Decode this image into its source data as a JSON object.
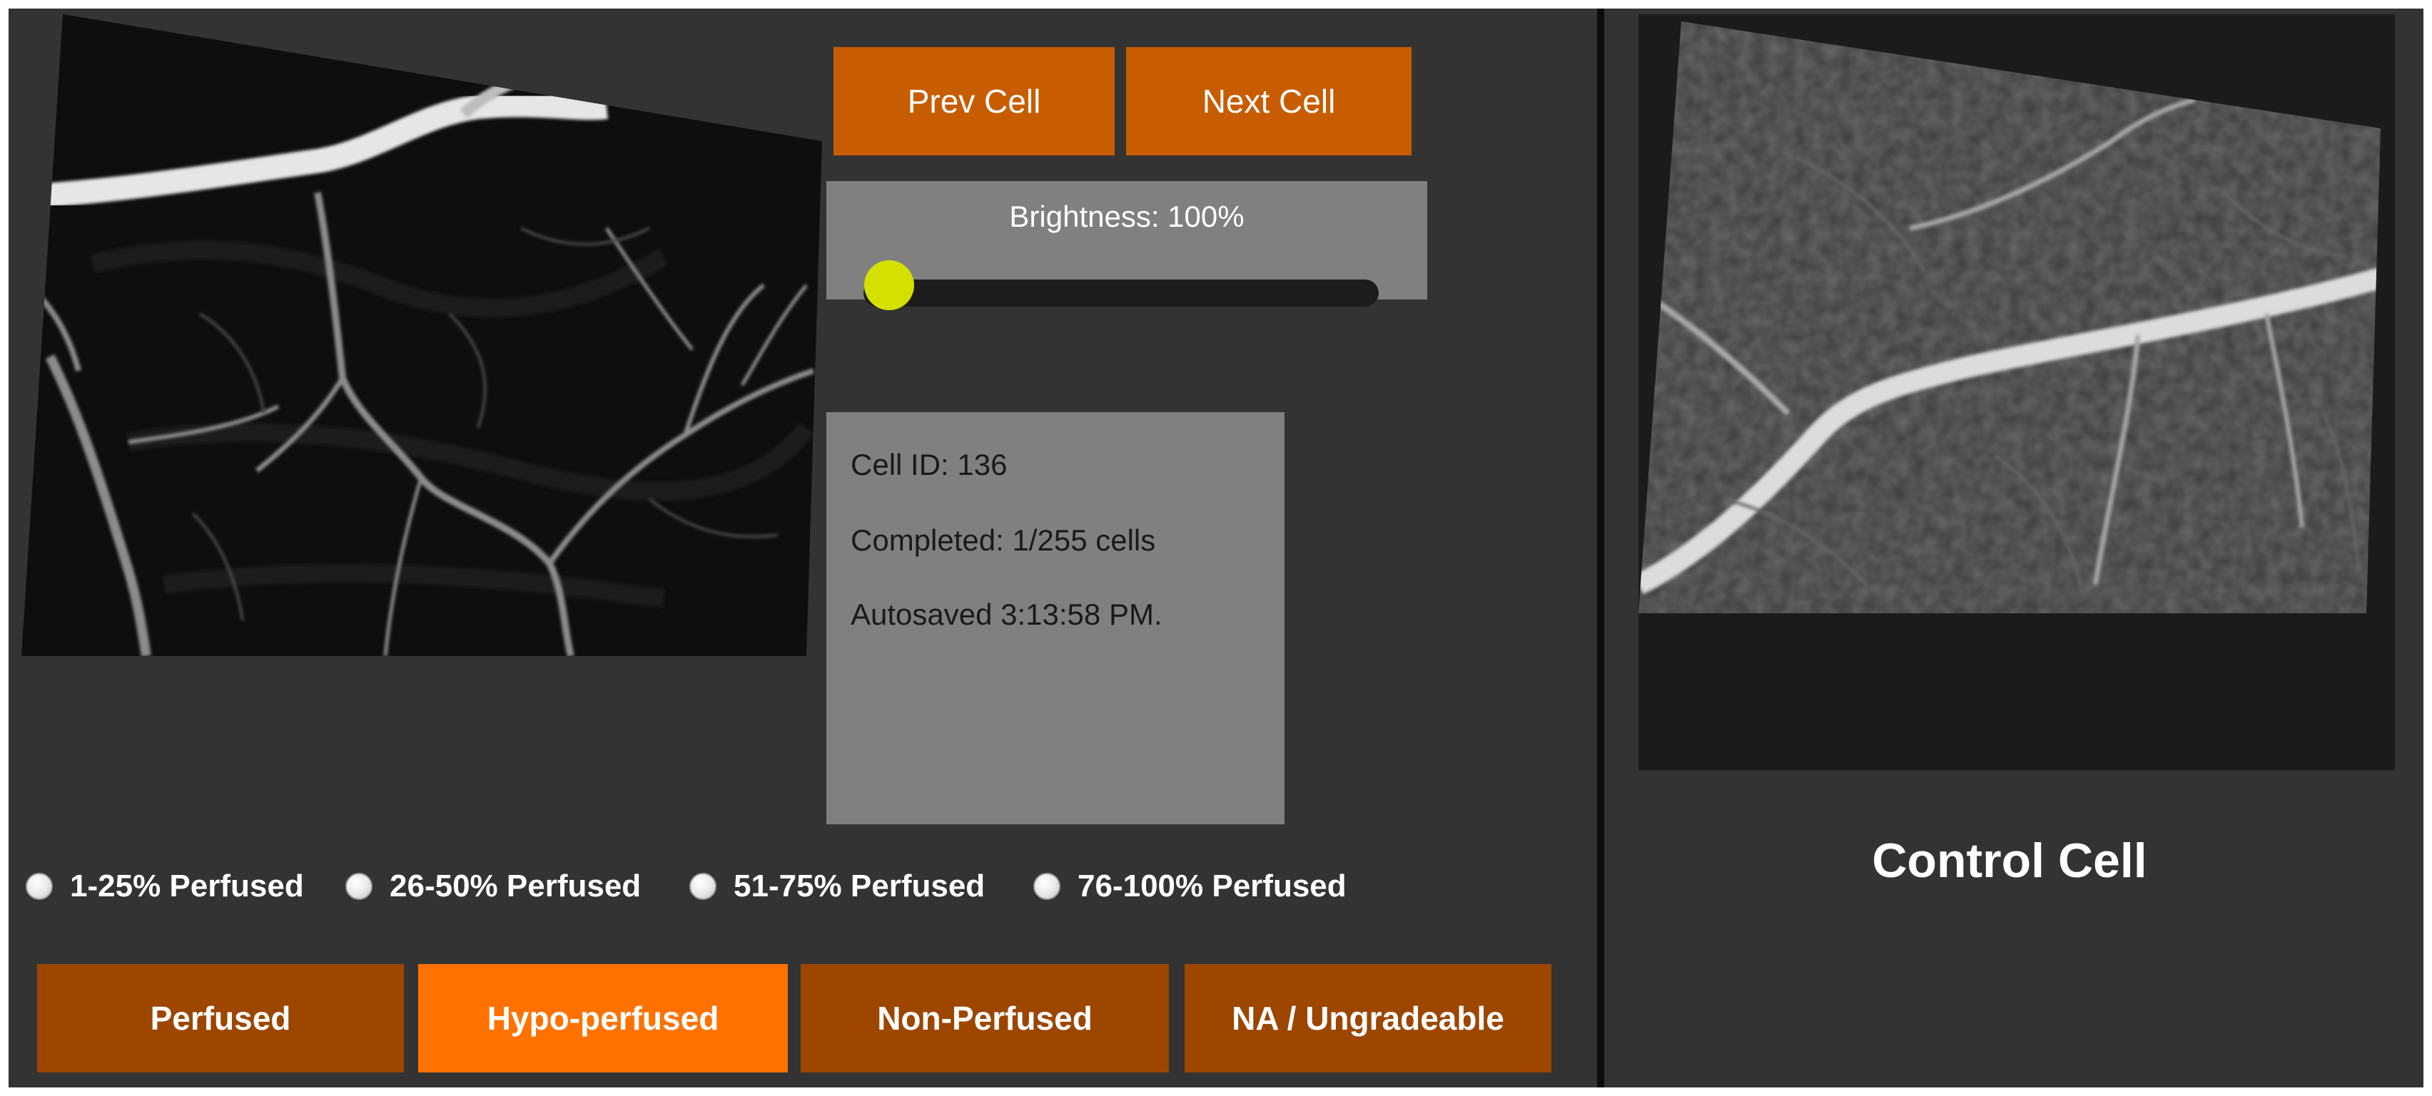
{
  "navigation": {
    "prev_label": "Prev Cell",
    "next_label": "Next Cell"
  },
  "brightness": {
    "label": "Brightness: 100%",
    "value_percent": 100,
    "thumb_fraction": 0.05,
    "thumb_color": "#d4e000"
  },
  "info": {
    "cell_id": "Cell ID: 136",
    "completed": "Completed: 1/255 cells",
    "autosaved": "Autosaved 3:13:58 PM."
  },
  "perfusion_options": [
    {
      "label": "1-25% Perfused"
    },
    {
      "label": "26-50% Perfused"
    },
    {
      "label": "51-75% Perfused"
    },
    {
      "label": "76-100% Perfused"
    }
  ],
  "grade_buttons": [
    {
      "label": "Perfused",
      "active": false
    },
    {
      "label": "Hypo-perfused",
      "active": true
    },
    {
      "label": "Non-Perfused",
      "active": false
    },
    {
      "label": "NA / Ungradeable",
      "active": false
    }
  ],
  "control": {
    "label": "Control Cell"
  },
  "colors": {
    "background": "#333333",
    "nav_button": "#c85c00",
    "grade_button": "#9c4600",
    "grade_button_active": "#ff7200",
    "panel": "#808080"
  }
}
